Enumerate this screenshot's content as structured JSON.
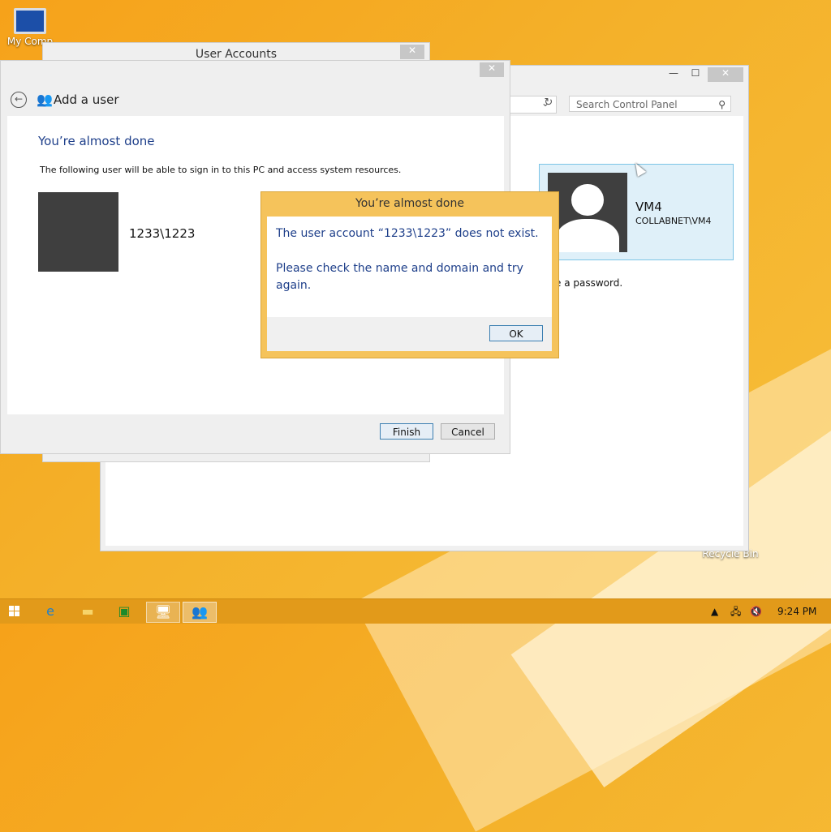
{
  "desktop": {
    "icons": [
      {
        "label": "My Comp"
      },
      {
        "label": "Recycle Bin"
      }
    ]
  },
  "control_panel": {
    "window_controls": {
      "minimize": "—",
      "maximize": "☐",
      "close": "✕"
    },
    "search_placeholder": "Search Control Panel",
    "help": "?",
    "user_tile": {
      "name": "VM4",
      "domain": "COLLABNET\\VM4"
    },
    "password_text": "e a password."
  },
  "user_accounts": {
    "title": "User Accounts",
    "close": "✕"
  },
  "add_user": {
    "close": "✕",
    "header": "Add a user",
    "heading": "You’re almost done",
    "description": "The following user will be able to sign in to this PC and access system resources.",
    "user": "1233\\1223",
    "buttons": {
      "finish": "Finish",
      "cancel": "Cancel"
    }
  },
  "error_dialog": {
    "title": "You’re almost done",
    "message1": "The user account “1233\\1223” does not exist.",
    "message2": "Please check the name and domain and try again.",
    "ok": "OK"
  },
  "taskbar": {
    "items": [
      "start",
      "internet-explorer",
      "file-explorer",
      "store",
      "control-panel",
      "user-accounts"
    ],
    "clock": "9:24 PM"
  },
  "colors": {
    "desktop": "#f6a21a",
    "dialog_border": "#f5c35b",
    "heading_blue": "#1e3f8a"
  }
}
